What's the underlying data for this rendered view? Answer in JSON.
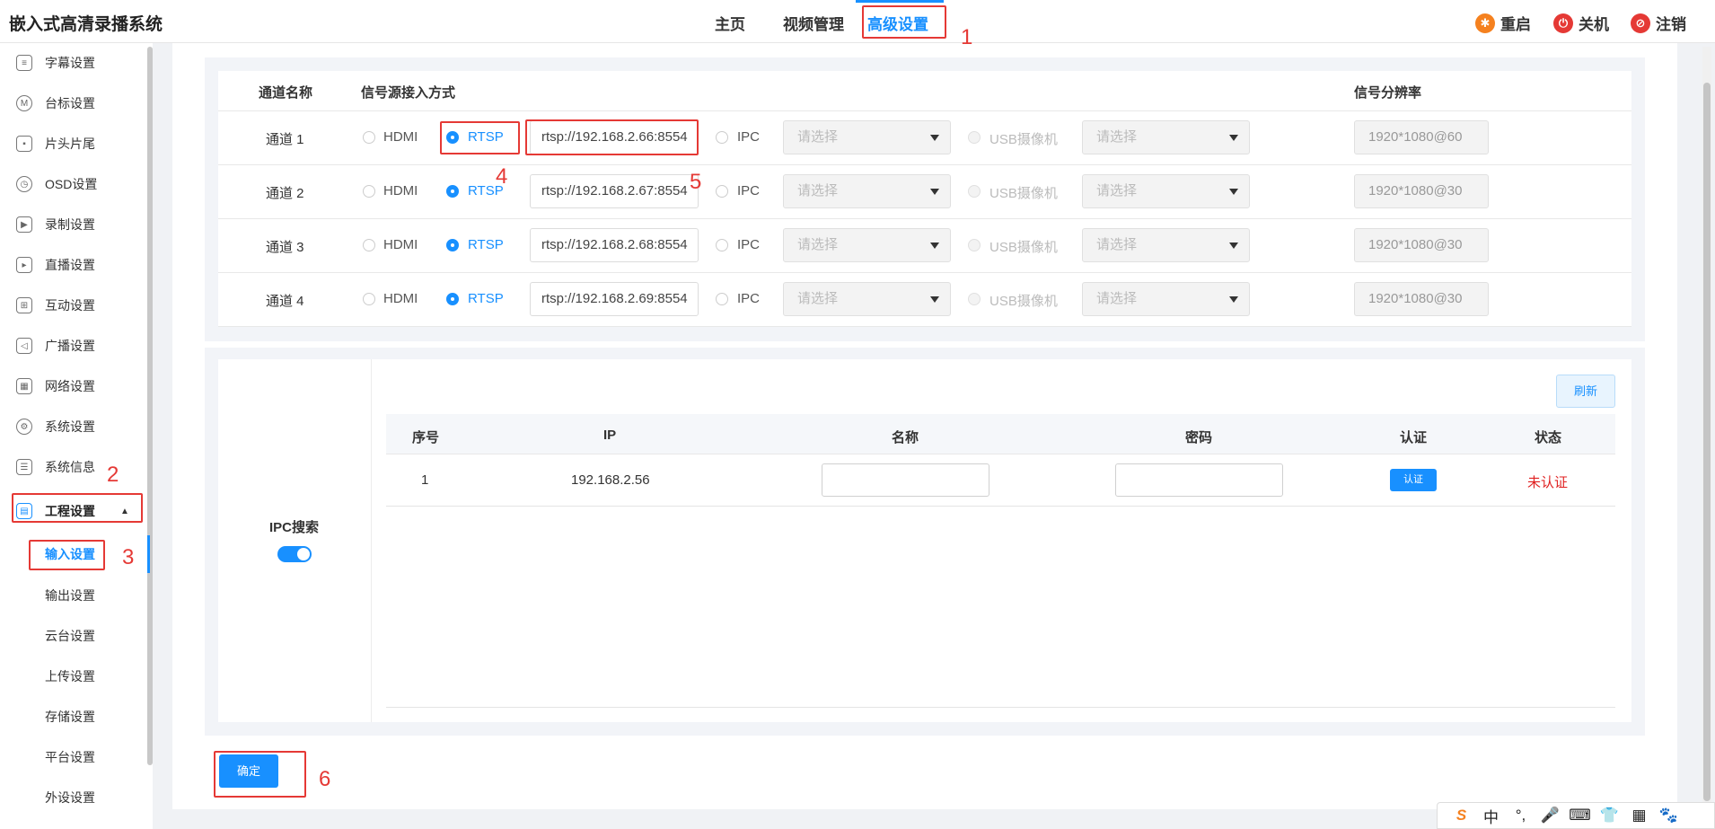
{
  "header": {
    "app_title": "嵌入式高清录播系统",
    "tabs": [
      {
        "label": "主页"
      },
      {
        "label": "视频管理"
      },
      {
        "label": "高级设置"
      }
    ],
    "actions": [
      {
        "label": "重启",
        "icon": "restart-icon",
        "color": "#f5811f"
      },
      {
        "label": "关机",
        "icon": "power-icon",
        "color": "#e53935"
      },
      {
        "label": "注销",
        "icon": "logout-icon",
        "color": "#e53935"
      }
    ]
  },
  "annotations": [
    "1",
    "2",
    "3",
    "4",
    "5",
    "6"
  ],
  "sidebar": {
    "items": [
      {
        "label": "字幕设置",
        "icon": "subtitle-icon"
      },
      {
        "label": "台标设置",
        "icon": "logo-icon",
        "glyph": "M"
      },
      {
        "label": "片头片尾",
        "icon": "clip-icon"
      },
      {
        "label": "OSD设置",
        "icon": "clock-icon"
      },
      {
        "label": "录制设置",
        "icon": "record-icon"
      },
      {
        "label": "直播设置",
        "icon": "live-icon"
      },
      {
        "label": "互动设置",
        "icon": "interact-icon"
      },
      {
        "label": "广播设置",
        "icon": "broadcast-icon"
      },
      {
        "label": "网络设置",
        "icon": "network-icon"
      },
      {
        "label": "系统设置",
        "icon": "gear-icon"
      },
      {
        "label": "系统信息",
        "icon": "info-icon"
      },
      {
        "label": "工程设置",
        "icon": "project-icon"
      }
    ],
    "sub_items": [
      {
        "label": "输入设置"
      },
      {
        "label": "输出设置"
      },
      {
        "label": "云台设置"
      },
      {
        "label": "上传设置"
      },
      {
        "label": "存储设置"
      },
      {
        "label": "平台设置"
      },
      {
        "label": "外设设置"
      }
    ]
  },
  "channels": {
    "headers": {
      "name": "通道名称",
      "source": "信号源接入方式",
      "resolution": "信号分辨率"
    },
    "options": {
      "hdmi": "HDMI",
      "rtsp": "RTSP",
      "ipc": "IPC",
      "usb": "USB摄像机",
      "select_placeholder": "请选择"
    },
    "rows": [
      {
        "name": "通道 1",
        "url": "rtsp://192.168.2.66:8554",
        "resolution": "1920*1080@60"
      },
      {
        "name": "通道 2",
        "url": "rtsp://192.168.2.67:8554",
        "resolution": "1920*1080@30"
      },
      {
        "name": "通道 3",
        "url": "rtsp://192.168.2.68:8554",
        "resolution": "1920*1080@30"
      },
      {
        "name": "通道 4",
        "url": "rtsp://192.168.2.69:8554",
        "resolution": "1920*1080@30"
      }
    ]
  },
  "ipc_search": {
    "label": "IPC搜索",
    "enabled": true,
    "refresh_label": "刷新",
    "headers": {
      "index": "序号",
      "ip": "IP",
      "name": "名称",
      "password": "密码",
      "auth": "认证",
      "status": "状态"
    },
    "rows": [
      {
        "index": "1",
        "ip": "192.168.2.56",
        "name": "",
        "password": "",
        "auth_label": "认证",
        "status": "未认证"
      }
    ]
  },
  "confirm_label": "确定",
  "ime": {
    "items": [
      "S",
      "中",
      "°,",
      "🎤",
      "⌨",
      "👕",
      "▦",
      "🐾"
    ]
  }
}
